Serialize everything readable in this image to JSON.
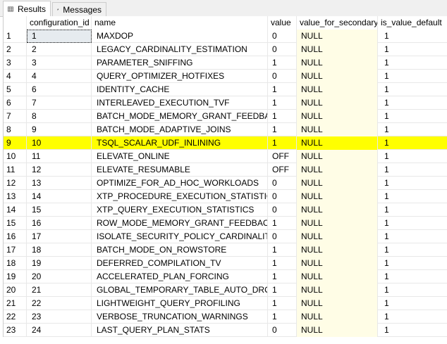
{
  "tabs": [
    {
      "label": "Results",
      "icon": "grid-icon"
    },
    {
      "label": "Messages",
      "icon": "messages-icon"
    }
  ],
  "columns": [
    "",
    "configuration_id",
    "name",
    "value",
    "value_for_secondary",
    "is_value_default"
  ],
  "highlight_color": "#ffff00",
  "highlighted_row": 9,
  "rows": [
    [
      "1",
      "1",
      "MAXDOP",
      "0",
      "NULL",
      "1"
    ],
    [
      "2",
      "2",
      "LEGACY_CARDINALITY_ESTIMATION",
      "0",
      "NULL",
      "1"
    ],
    [
      "3",
      "3",
      "PARAMETER_SNIFFING",
      "1",
      "NULL",
      "1"
    ],
    [
      "4",
      "4",
      "QUERY_OPTIMIZER_HOTFIXES",
      "0",
      "NULL",
      "1"
    ],
    [
      "5",
      "6",
      "IDENTITY_CACHE",
      "1",
      "NULL",
      "1"
    ],
    [
      "6",
      "7",
      "INTERLEAVED_EXECUTION_TVF",
      "1",
      "NULL",
      "1"
    ],
    [
      "7",
      "8",
      "BATCH_MODE_MEMORY_GRANT_FEEDBACK",
      "1",
      "NULL",
      "1"
    ],
    [
      "8",
      "9",
      "BATCH_MODE_ADAPTIVE_JOINS",
      "1",
      "NULL",
      "1"
    ],
    [
      "9",
      "10",
      "TSQL_SCALAR_UDF_INLINING",
      "1",
      "NULL",
      "1"
    ],
    [
      "10",
      "11",
      "ELEVATE_ONLINE",
      "OFF",
      "NULL",
      "1"
    ],
    [
      "11",
      "12",
      "ELEVATE_RESUMABLE",
      "OFF",
      "NULL",
      "1"
    ],
    [
      "12",
      "13",
      "OPTIMIZE_FOR_AD_HOC_WORKLOADS",
      "0",
      "NULL",
      "1"
    ],
    [
      "13",
      "14",
      "XTP_PROCEDURE_EXECUTION_STATISTICS",
      "0",
      "NULL",
      "1"
    ],
    [
      "14",
      "15",
      "XTP_QUERY_EXECUTION_STATISTICS",
      "0",
      "NULL",
      "1"
    ],
    [
      "15",
      "16",
      "ROW_MODE_MEMORY_GRANT_FEEDBACK",
      "1",
      "NULL",
      "1"
    ],
    [
      "16",
      "17",
      "ISOLATE_SECURITY_POLICY_CARDINALITY",
      "0",
      "NULL",
      "1"
    ],
    [
      "17",
      "18",
      "BATCH_MODE_ON_ROWSTORE",
      "1",
      "NULL",
      "1"
    ],
    [
      "18",
      "19",
      "DEFERRED_COMPILATION_TV",
      "1",
      "NULL",
      "1"
    ],
    [
      "19",
      "20",
      "ACCELERATED_PLAN_FORCING",
      "1",
      "NULL",
      "1"
    ],
    [
      "20",
      "21",
      "GLOBAL_TEMPORARY_TABLE_AUTO_DROP",
      "1",
      "NULL",
      "1"
    ],
    [
      "21",
      "22",
      "LIGHTWEIGHT_QUERY_PROFILING",
      "1",
      "NULL",
      "1"
    ],
    [
      "22",
      "23",
      "VERBOSE_TRUNCATION_WARNINGS",
      "1",
      "NULL",
      "1"
    ],
    [
      "23",
      "24",
      "LAST_QUERY_PLAN_STATS",
      "0",
      "NULL",
      "1"
    ]
  ]
}
